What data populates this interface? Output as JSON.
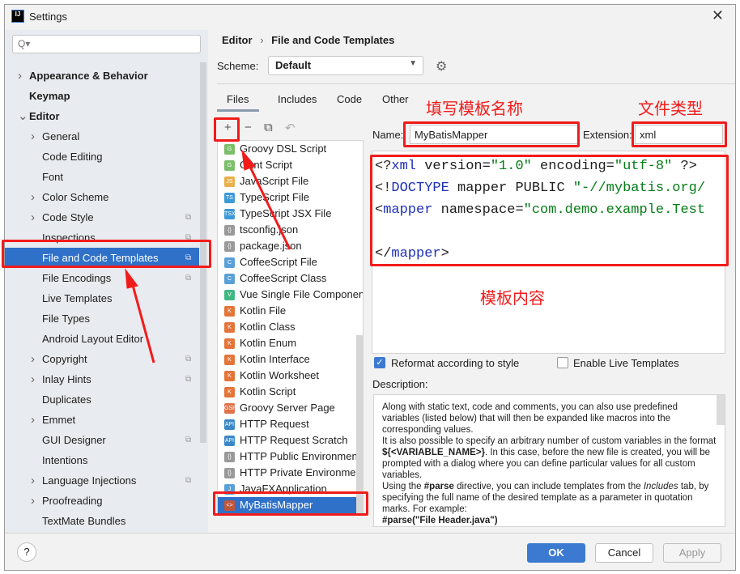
{
  "window": {
    "title": "Settings",
    "logo": "IJ"
  },
  "search": {
    "placeholder": "Q▾"
  },
  "sidebar": {
    "items": [
      {
        "label": "Appearance & Behavior",
        "level": 0,
        "bold": true,
        "chevron": "right"
      },
      {
        "label": "Keymap",
        "level": 0,
        "bold": true
      },
      {
        "label": "Editor",
        "level": 0,
        "bold": true,
        "chevron": "down"
      },
      {
        "label": "General",
        "level": 1,
        "chevron": "right"
      },
      {
        "label": "Code Editing",
        "level": 1
      },
      {
        "label": "Font",
        "level": 1
      },
      {
        "label": "Color Scheme",
        "level": 1,
        "chevron": "right"
      },
      {
        "label": "Code Style",
        "level": 1,
        "chevron": "right",
        "copy": true
      },
      {
        "label": "Inspections",
        "level": 1,
        "copy": true
      },
      {
        "label": "File and Code Templates",
        "level": 1,
        "copy": true,
        "selected": true
      },
      {
        "label": "File Encodings",
        "level": 1,
        "copy": true
      },
      {
        "label": "Live Templates",
        "level": 1
      },
      {
        "label": "File Types",
        "level": 1
      },
      {
        "label": "Android Layout Editor",
        "level": 1
      },
      {
        "label": "Copyright",
        "level": 1,
        "chevron": "right",
        "copy": true
      },
      {
        "label": "Inlay Hints",
        "level": 1,
        "chevron": "right",
        "copy": true
      },
      {
        "label": "Duplicates",
        "level": 1
      },
      {
        "label": "Emmet",
        "level": 1,
        "chevron": "right"
      },
      {
        "label": "GUI Designer",
        "level": 1,
        "copy": true
      },
      {
        "label": "Intentions",
        "level": 1
      },
      {
        "label": "Language Injections",
        "level": 1,
        "chevron": "right",
        "copy": true
      },
      {
        "label": "Proofreading",
        "level": 1,
        "chevron": "right"
      },
      {
        "label": "TextMate Bundles",
        "level": 1
      }
    ]
  },
  "breadcrumb": {
    "parent": "Editor",
    "sep": "›",
    "current": "File and Code Templates"
  },
  "scheme": {
    "label": "Scheme:",
    "value": "Default"
  },
  "tabs": [
    {
      "label": "Files",
      "active": true
    },
    {
      "label": "Includes"
    },
    {
      "label": "Code"
    },
    {
      "label": "Other"
    }
  ],
  "toolbar": {
    "add": "+",
    "remove": "−",
    "copy": "⧉",
    "reset": "↶"
  },
  "files": [
    {
      "label": "Groovy DSL Script",
      "icon": "G",
      "color": "#7cbf6a"
    },
    {
      "label": "Gant Script",
      "icon": "G",
      "color": "#7cbf6a"
    },
    {
      "label": "JavaScript File",
      "icon": "JS",
      "color": "#e8b04a"
    },
    {
      "label": "TypeScript File",
      "icon": "TS",
      "color": "#3c9ad6"
    },
    {
      "label": "TypeScript JSX File",
      "icon": "TSX",
      "color": "#3c9ad6"
    },
    {
      "label": "tsconfig.json",
      "icon": "{}",
      "color": "#999999"
    },
    {
      "label": "package.json",
      "icon": "{}",
      "color": "#999999"
    },
    {
      "label": "CoffeeScript File",
      "icon": "C",
      "color": "#5aa0d8"
    },
    {
      "label": "CoffeeScript Class",
      "icon": "C",
      "color": "#5aa0d8"
    },
    {
      "label": "Vue Single File Component",
      "icon": "V",
      "color": "#41b883"
    },
    {
      "label": "Kotlin File",
      "icon": "K",
      "color": "#e4753a"
    },
    {
      "label": "Kotlin Class",
      "icon": "K",
      "color": "#e4753a"
    },
    {
      "label": "Kotlin Enum",
      "icon": "K",
      "color": "#e4753a"
    },
    {
      "label": "Kotlin Interface",
      "icon": "K",
      "color": "#e4753a"
    },
    {
      "label": "Kotlin Worksheet",
      "icon": "K",
      "color": "#e4753a"
    },
    {
      "label": "Kotlin Script",
      "icon": "K",
      "color": "#e4753a"
    },
    {
      "label": "Groovy Server Page",
      "icon": "GSP",
      "color": "#e0734a"
    },
    {
      "label": "HTTP Request",
      "icon": "API",
      "color": "#3c87c8"
    },
    {
      "label": "HTTP Request Scratch",
      "icon": "API",
      "color": "#3c87c8"
    },
    {
      "label": "HTTP Public Environment File",
      "icon": "{}",
      "color": "#999999"
    },
    {
      "label": "HTTP Private Environment File",
      "icon": "{}",
      "color": "#999999"
    },
    {
      "label": "JavaFXApplication",
      "icon": "J",
      "color": "#5aa0d8"
    },
    {
      "label": "MyBatisMapper",
      "icon": "<>",
      "color": "#c0563a",
      "selected": true
    }
  ],
  "template": {
    "name_label": "Name:",
    "name": "MyBatisMapper",
    "ext_label": "Extension:",
    "ext": "xml",
    "code_lines": [
      "<?xml version=\"1.0\" encoding=\"utf-8\" ?>",
      "<!DOCTYPE mapper PUBLIC \"-//mybatis.org/",
      "<mapper namespace=\"com.demo.example.Test",
      "",
      "</mapper>"
    ]
  },
  "options": {
    "reformat": {
      "label": "Reformat according to style",
      "checked": true
    },
    "live": {
      "label": "Enable Live Templates",
      "checked": false
    }
  },
  "description": {
    "label": "Description:",
    "p1": "Along with static text, code and comments, you can also use predefined variables (listed below) that will then be expanded like macros into the corresponding values.",
    "p2a": "It is also possible to specify an arbitrary number of custom variables in the format ",
    "p2b": "${<VARIABLE_NAME>}",
    "p2c": ". In this case, before the new file is created, you will be prompted with a dialog where you can define particular values for all custom variables.",
    "p3a": "Using the ",
    "p3b": "#parse",
    "p3c": " directive, you can include templates from the ",
    "p3d": "Includes",
    "p3e": " tab, by specifying the full name of the desired template as a parameter in quotation marks. For example:",
    "p4": "#parse(\"File Header.java\")"
  },
  "footer": {
    "help": "?",
    "ok": "OK",
    "cancel": "Cancel",
    "apply": "Apply"
  },
  "annotations": {
    "name_note": "填写模板名称",
    "type_note": "文件类型",
    "content_note": "模板内容",
    "color": "#f21b1b"
  }
}
